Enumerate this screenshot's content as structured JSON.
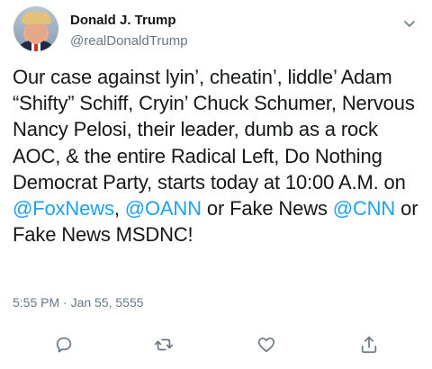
{
  "author": {
    "name": "Donald J. Trump",
    "handle": "@realDonaldTrump"
  },
  "tweet": {
    "segments": [
      {
        "text": "Our case against lyin’, cheatin’, liddle’ Adam “Shifty” Schiff, Cryin’ Chuck Schumer, Nervous Nancy Pelosi, their leader, dumb as a rock AOC, & the entire Radical Left, Do Nothing Democrat Party, starts today at 10:00 A.M. on ",
        "mention": false
      },
      {
        "text": "@FoxNews",
        "mention": true
      },
      {
        "text": ", ",
        "mention": false
      },
      {
        "text": "@OANN",
        "mention": true
      },
      {
        "text": " or Fake News ",
        "mention": false
      },
      {
        "text": "@CNN",
        "mention": true
      },
      {
        "text": " or Fake News MSDNC!",
        "mention": false
      }
    ],
    "timestamp": "5:55 PM · Jan 55, 5555"
  },
  "actions": {
    "icons": [
      "reply-icon",
      "retweet-icon",
      "like-icon",
      "share-icon"
    ]
  },
  "colors": {
    "text": "#14171a",
    "secondary": "#657786",
    "link": "#1da1f2",
    "icon": "#657786"
  }
}
